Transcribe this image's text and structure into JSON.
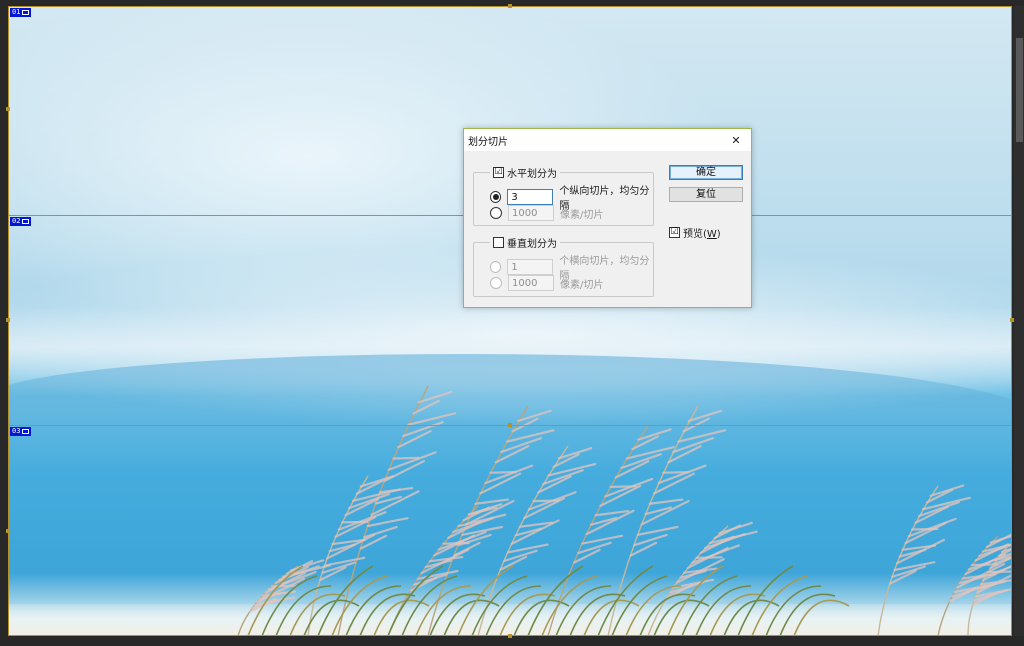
{
  "slices": {
    "tags": [
      "01",
      "02",
      "03"
    ]
  },
  "dialog": {
    "title": "划分切片",
    "close_glyph": "✕",
    "horizontal": {
      "checked": true,
      "check_glyph": "☑",
      "label": "水平划分为",
      "option1": {
        "selected": true,
        "value": "3",
        "suffix": "个纵向切片，均匀分隔"
      },
      "option2": {
        "selected": false,
        "value": "1000",
        "suffix": "像素/切片"
      }
    },
    "vertical": {
      "checked": false,
      "check_glyph": "",
      "label": "垂直划分为",
      "option1": {
        "selected": false,
        "value": "1",
        "suffix": "个横向切片，均匀分隔"
      },
      "option2": {
        "selected": false,
        "value": "1000",
        "suffix": "像素/切片"
      }
    },
    "ok_label": "确定",
    "reset_label": "复位",
    "preview": {
      "checked": true,
      "check_glyph": "☑",
      "label_prefix": "预览(",
      "accel": "W",
      "label_suffix": ")"
    }
  },
  "colors": {
    "slice_line": "#b4912a",
    "slice_tag_bg": "#0017d6",
    "dialog_border": "#9cb84b",
    "primary_button_border": "#3c7fb1"
  },
  "icons": {
    "close": "close-icon",
    "slice_tag": "image-slice-icon"
  }
}
